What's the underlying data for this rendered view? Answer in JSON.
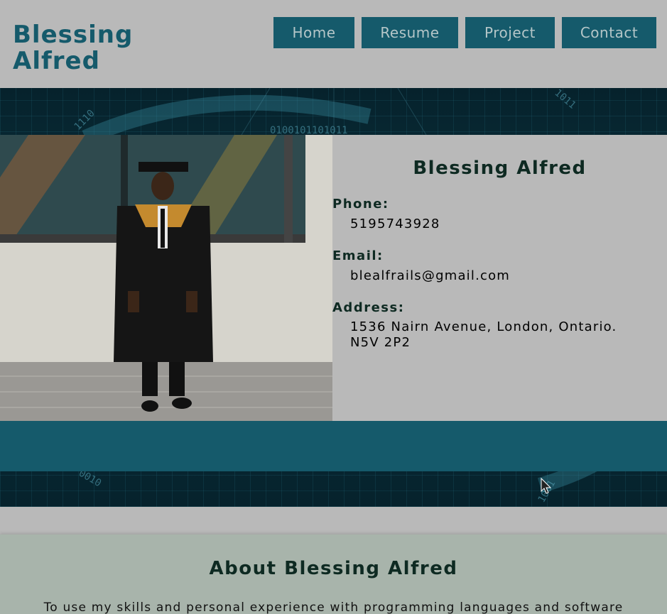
{
  "header": {
    "brand": "Blessing Alfred",
    "nav": [
      {
        "label": "Home"
      },
      {
        "label": "Resume"
      },
      {
        "label": "Project"
      },
      {
        "label": "Contact"
      }
    ]
  },
  "profile": {
    "name": "Blessing Alfred",
    "phone_label": "Phone:",
    "phone": "5195743928",
    "email_label": "Email:",
    "email": "blealfrails@gmail.com",
    "address_label": "Address:",
    "address": "1536 Nairn Avenue, London, Ontario. N5V 2P2"
  },
  "about": {
    "title": "About Blessing Alfred",
    "text": "To use my skills and personal experience with programming languages and software"
  },
  "colors": {
    "accent": "#155a6b",
    "page_bg": "#b9b9b9",
    "about_bg": "#a8b4ab",
    "nav_text": "#b4c6c8"
  }
}
